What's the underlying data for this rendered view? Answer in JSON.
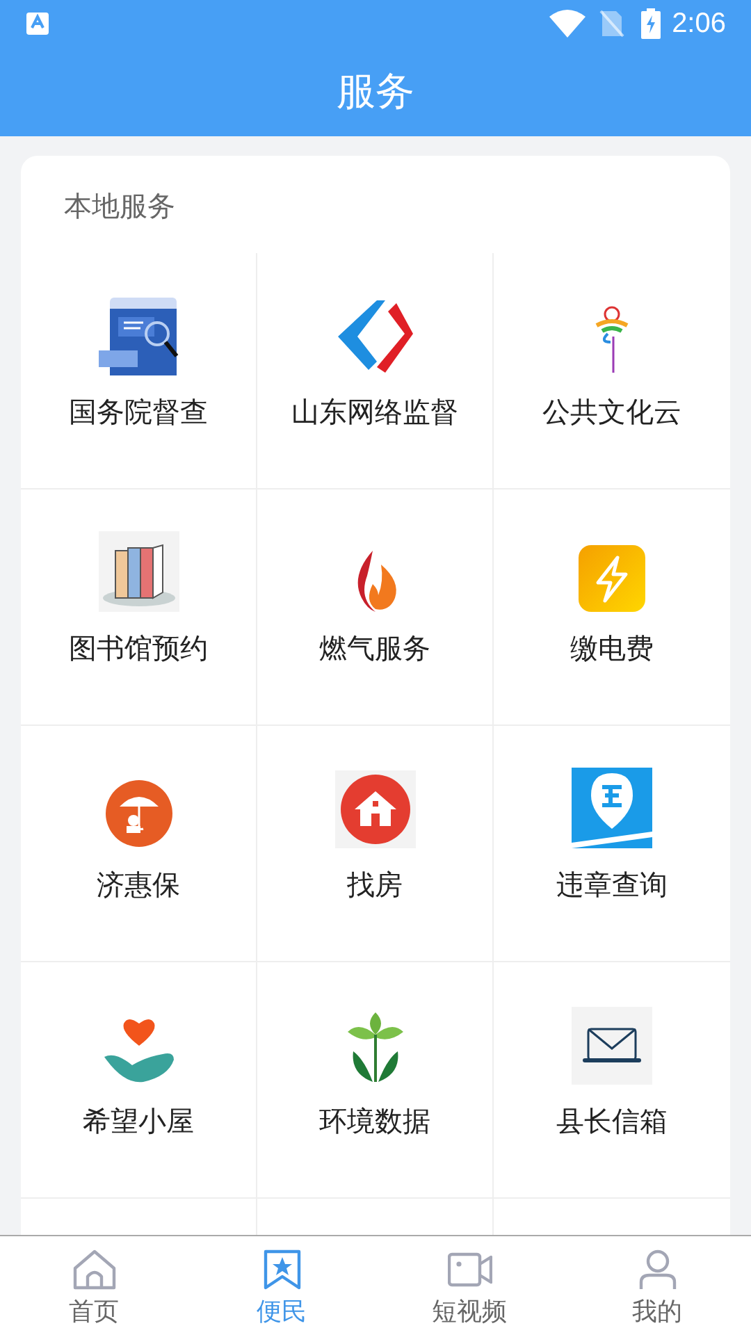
{
  "status_bar": {
    "time": "2:06"
  },
  "header": {
    "title": "服务"
  },
  "section": {
    "title": "本地服务",
    "items": [
      {
        "label": "国务院督查"
      },
      {
        "label": "山东网络监督"
      },
      {
        "label": "公共文化云"
      },
      {
        "label": "图书馆预约"
      },
      {
        "label": "燃气服务"
      },
      {
        "label": "缴电费"
      },
      {
        "label": "济惠保"
      },
      {
        "label": "找房"
      },
      {
        "label": "违章查询"
      },
      {
        "label": "希望小屋"
      },
      {
        "label": "环境数据"
      },
      {
        "label": "县长信箱"
      }
    ]
  },
  "bottom_nav": [
    {
      "label": "首页",
      "selected": false
    },
    {
      "label": "便民",
      "selected": true
    },
    {
      "label": "短视频",
      "selected": false
    },
    {
      "label": "我的",
      "selected": false
    }
  ]
}
